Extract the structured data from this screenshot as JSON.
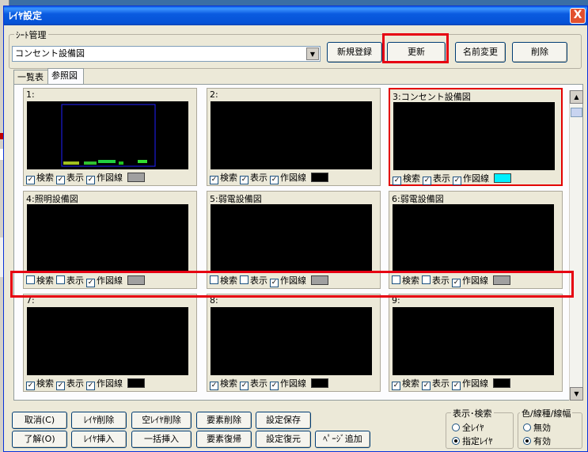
{
  "window": {
    "title": "ﾚｲﾔ設定",
    "close_label": "X"
  },
  "sheet": {
    "legend": "ｼｰﾄ管理",
    "selected": "コンセント設備図",
    "buttons": {
      "register": "新規登録",
      "update": "更新",
      "rename": "名前変更",
      "delete": "削除"
    }
  },
  "tabs": [
    {
      "label": "一覧表"
    },
    {
      "label": "参照図"
    }
  ],
  "options": {
    "search": "検索",
    "display": "表示",
    "draw_line": "作図線"
  },
  "cells": [
    {
      "title": "1:",
      "search": true,
      "display": true,
      "draw": true,
      "color": "#a0a0a0"
    },
    {
      "title": "2:",
      "search": true,
      "display": true,
      "draw": true,
      "color": "#000000"
    },
    {
      "title": "3:コンセント設備図",
      "search": true,
      "display": true,
      "draw": true,
      "color": "#00f0ff"
    },
    {
      "title": "4:照明設備図",
      "search": false,
      "display": false,
      "draw": true,
      "color": "#a0a0a0"
    },
    {
      "title": "5:弱電設備図",
      "search": false,
      "display": false,
      "draw": true,
      "color": "#a0a0a0"
    },
    {
      "title": "6:弱電設備図",
      "search": false,
      "display": false,
      "draw": true,
      "color": "#a0a0a0"
    },
    {
      "title": "7:",
      "search": true,
      "display": true,
      "draw": true,
      "color": "#000000"
    },
    {
      "title": "8:",
      "search": true,
      "display": true,
      "draw": true,
      "color": "#000000"
    },
    {
      "title": "9:",
      "search": true,
      "display": true,
      "draw": true,
      "color": "#000000"
    }
  ],
  "bottom": {
    "cancel": "取消(C)",
    "ok": "了解(O)",
    "layer_delete": "ﾚｲﾔ削除",
    "layer_insert": "ﾚｲﾔ挿入",
    "empty_delete": "空ﾚｲﾔ削除",
    "bulk_insert": "一括挿入",
    "elem_delete": "要素削除",
    "elem_restore": "要素復帰",
    "save": "設定保存",
    "restore": "設定復元",
    "page_add": "ﾍﾟｰｼﾞ追加"
  },
  "display_search": {
    "legend": "表示･検索",
    "all": "全ﾚｲﾔ",
    "specified": "指定ﾚｲﾔ",
    "selected": "specified"
  },
  "color_linetype": {
    "legend": "色/線種/線幅",
    "off": "無効",
    "on": "有効",
    "selected": "on"
  },
  "colors": {
    "highlight_red": "#e60012",
    "cyan_swatch": "#00f0ff"
  }
}
